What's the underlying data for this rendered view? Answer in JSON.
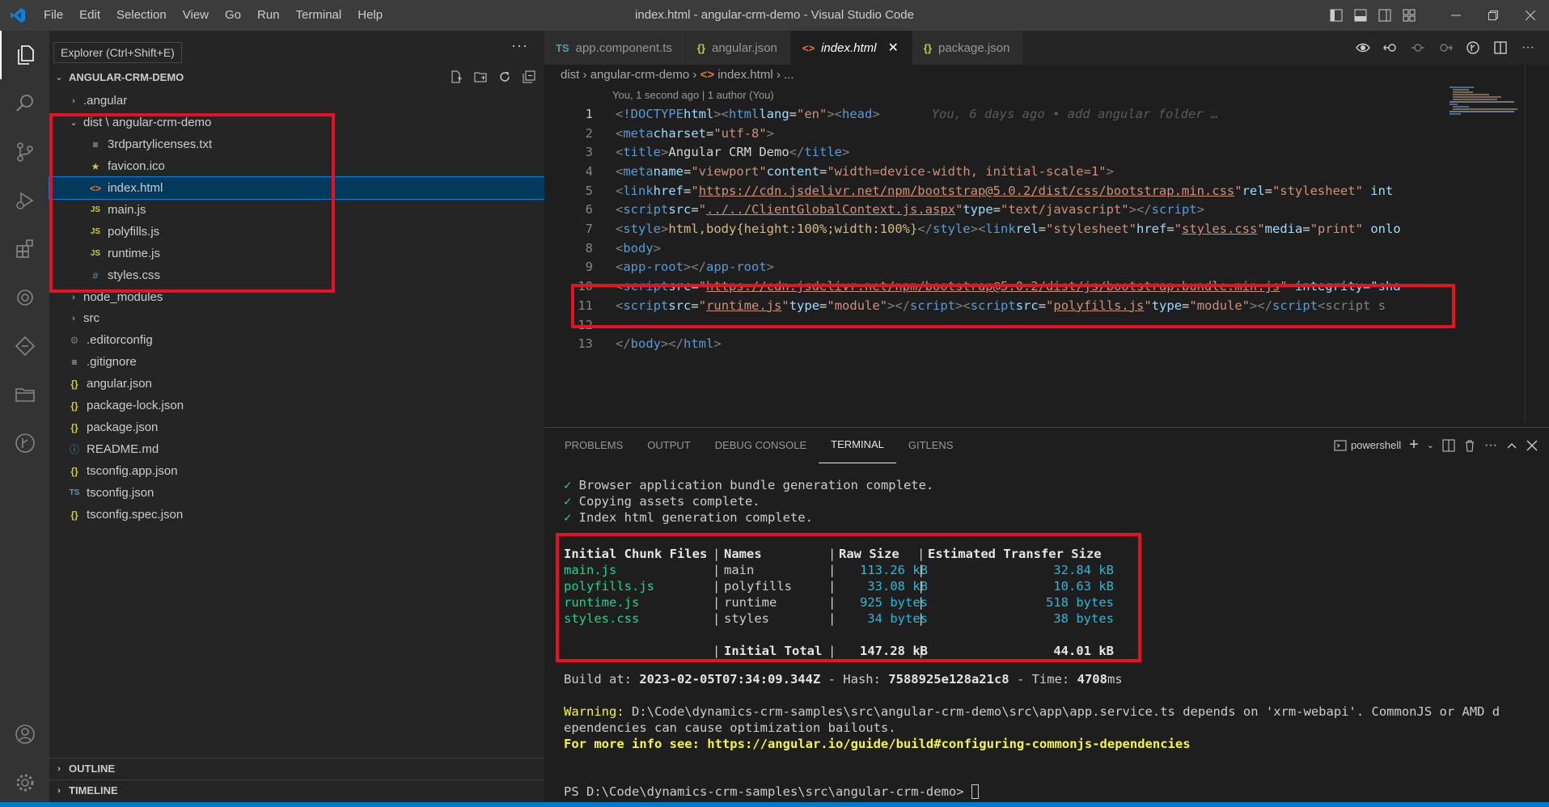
{
  "window": {
    "title": "index.html - angular-crm-demo - Visual Studio Code",
    "menu": [
      "File",
      "Edit",
      "Selection",
      "View",
      "Go",
      "Run",
      "Terminal",
      "Help"
    ]
  },
  "tooltip": "Explorer (Ctrl+Shift+E)",
  "explorer": {
    "project": "ANGULAR-CRM-DEMO",
    "items": [
      {
        "label": ".angular",
        "icon": "chevron-right-icon"
      },
      {
        "label": "dist \\ angular-crm-demo",
        "icon": "chevron-down-icon"
      },
      {
        "label": "3rdpartylicenses.txt",
        "icon": "text-file-icon"
      },
      {
        "label": "favicon.ico",
        "icon": "star-icon"
      },
      {
        "label": "index.html",
        "icon": "html-icon"
      },
      {
        "label": "main.js",
        "icon": "js-icon"
      },
      {
        "label": "polyfills.js",
        "icon": "js-icon"
      },
      {
        "label": "runtime.js",
        "icon": "js-icon"
      },
      {
        "label": "styles.css",
        "icon": "css-icon"
      },
      {
        "label": "node_modules",
        "icon": "chevron-right-icon"
      },
      {
        "label": "src",
        "icon": "chevron-right-icon"
      },
      {
        "label": ".editorconfig",
        "icon": "gear-icon"
      },
      {
        "label": ".gitignore",
        "icon": "text-file-icon"
      },
      {
        "label": "angular.json",
        "icon": "json-icon"
      },
      {
        "label": "package-lock.json",
        "icon": "json-icon"
      },
      {
        "label": "package.json",
        "icon": "json-icon"
      },
      {
        "label": "README.md",
        "icon": "info-icon"
      },
      {
        "label": "tsconfig.app.json",
        "icon": "json-icon"
      },
      {
        "label": "tsconfig.json",
        "icon": "ts-icon"
      },
      {
        "label": "tsconfig.spec.json",
        "icon": "json-icon"
      }
    ],
    "outline": "OUTLINE",
    "timeline": "TIMELINE"
  },
  "tabs": [
    {
      "label": "app.component.ts",
      "icon": "TS"
    },
    {
      "label": "angular.json",
      "icon": "{}"
    },
    {
      "label": "index.html",
      "icon": "<>"
    },
    {
      "label": "package.json",
      "icon": "{}"
    }
  ],
  "breadcrumb": {
    "part1": "dist",
    "part2": "angular-crm-demo",
    "part3": "index.html",
    "part4": "..."
  },
  "blame_header": "You, 1 second ago | 1 author (You)",
  "code": {
    "line_numbers": [
      "1",
      "2",
      "3",
      "4",
      "5",
      "6",
      "7",
      "8",
      "9",
      "10",
      "11",
      "12",
      "13"
    ],
    "l1_blame": "You, 6 days ago • add angular folder …",
    "l2_attr": "charset",
    "l2_val": "\"utf-8\"",
    "l3_text": "Angular CRM Demo",
    "l4_name": "\"viewport\"",
    "l4_content": "\"width=device-width, initial-scale=1\"",
    "l5_href": "https://cdn.jsdelivr.net/npm/bootstrap@5.0.2/dist/css/bootstrap.min.css",
    "l5_rel": "\"stylesheet\"",
    "l5_tail": " int",
    "l6_src": "../../ClientGlobalContext.js.aspx",
    "l6_type": "\"text/javascript\"",
    "l7_css": "html,body{height:100%;width:100%}",
    "l7_href": "styles.css",
    "l7_media": "\"print\"",
    "l7_tail": " onlo",
    "l10_src": "https://cdn.jsdelivr.net/npm/bootstrap@5.0.2/dist/js/bootstrap.bundle.min.js",
    "l10_tail": " integrity=\"sha",
    "l11_src1": "runtime.js",
    "l11_type": "\"module\"",
    "l11_src2": "polyfills.js",
    "l11_tail": "<script s"
  },
  "panel": {
    "tabs": [
      "PROBLEMS",
      "OUTPUT",
      "DEBUG CONSOLE",
      "TERMINAL",
      "GITLENS"
    ],
    "shell": "powershell"
  },
  "terminal": {
    "status": [
      "Browser application bundle generation complete.",
      "Copying assets complete.",
      "Index html generation complete."
    ],
    "headers": [
      "Initial Chunk Files",
      "Names",
      "Raw Size",
      "Estimated Transfer Size"
    ],
    "rows": [
      [
        "main.js",
        "main",
        "113.26 kB",
        "32.84 kB"
      ],
      [
        "polyfills.js",
        "polyfills",
        "33.08 kB",
        "10.63 kB"
      ],
      [
        "runtime.js",
        "runtime",
        "925 bytes",
        "518 bytes"
      ],
      [
        "styles.css",
        "styles",
        "34 bytes",
        "38 bytes"
      ]
    ],
    "total_label": "Initial Total",
    "total_raw": "147.28 kB",
    "total_transfer": "44.01 kB",
    "build_at_label": "Build at: ",
    "build_at": "2023-02-05T07:34:09.344Z",
    "hash_label": " - Hash: ",
    "hash": "7588925e128a21c8",
    "time_label": " - Time: ",
    "time": "4708",
    "time_unit": "ms",
    "warning_label": "Warning:",
    "warning_text": " D:\\Code\\dynamics-crm-samples\\src\\angular-crm-demo\\src\\app\\app.service.ts depends on 'xrm-webapi'. CommonJS or AMD d",
    "warning_text2": "ependencies can cause optimization bailouts.",
    "more_info": "For more info see: https://angular.io/guide/build#configuring-commonjs-dependencies",
    "prompt": "PS D:\\Code\\dynamics-crm-samples\\src\\angular-crm-demo> "
  }
}
